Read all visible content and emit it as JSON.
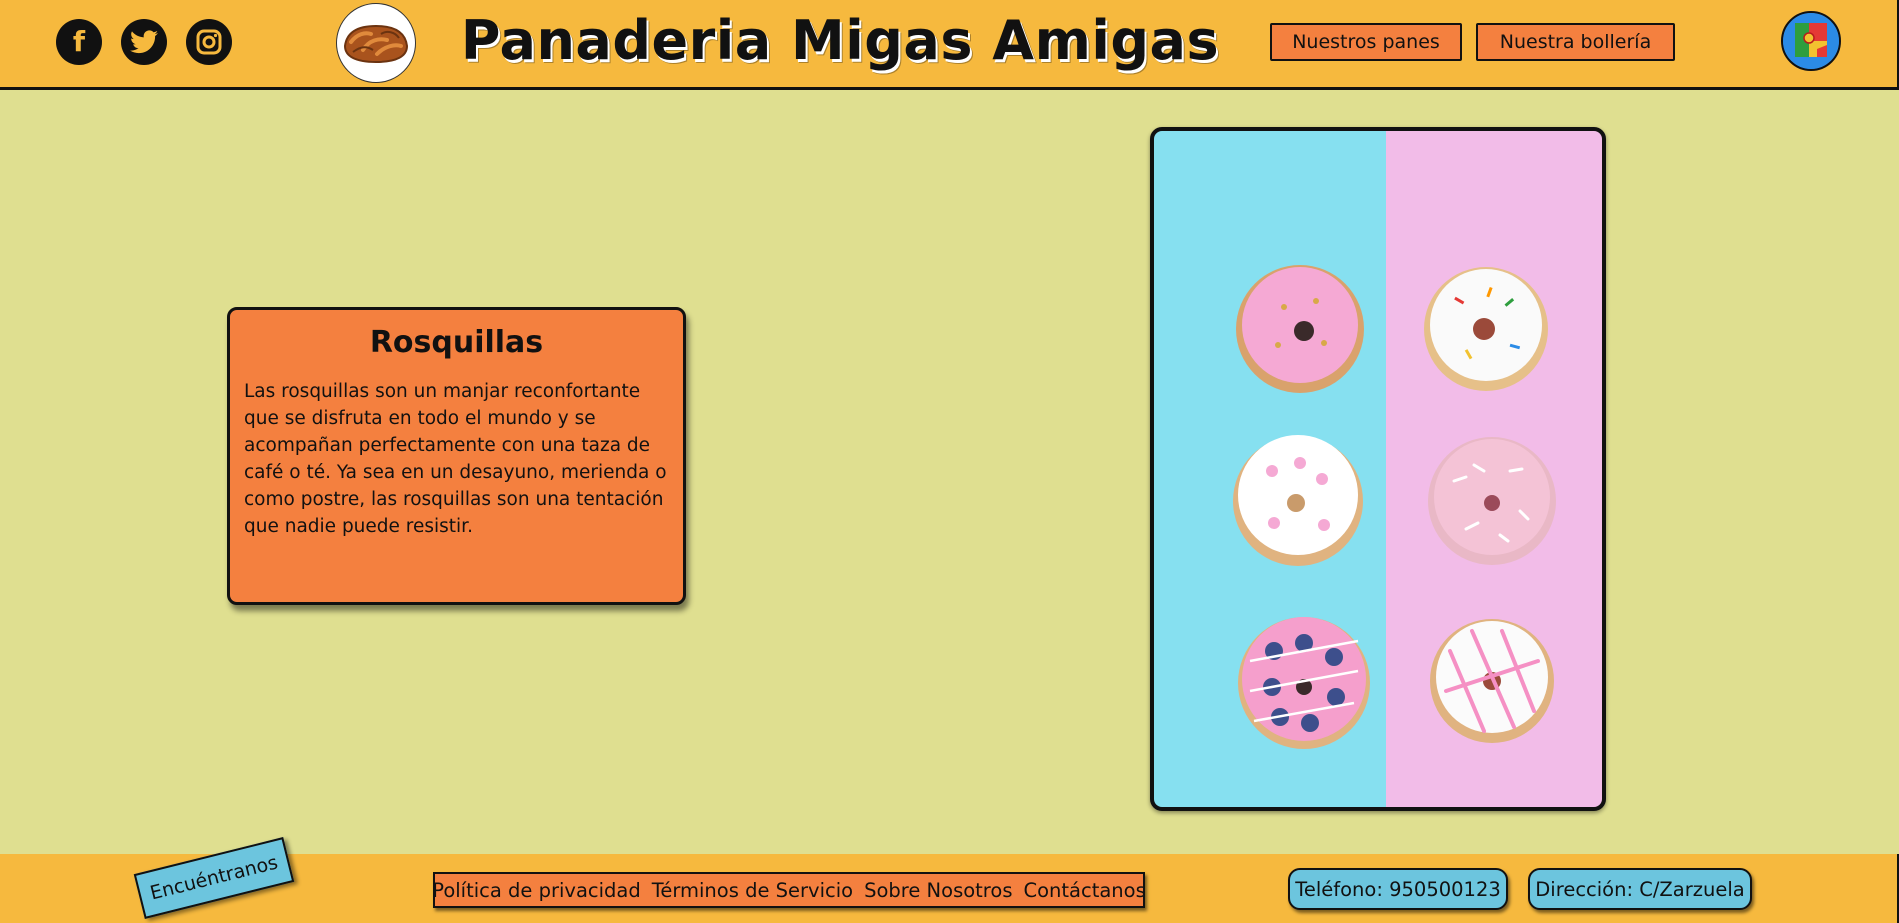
{
  "header": {
    "title": "Panaderia Migas Amigas",
    "social": [
      {
        "icon": "facebook-icon",
        "glyph": "f"
      },
      {
        "icon": "twitter-icon"
      },
      {
        "icon": "instagram-icon"
      }
    ],
    "logo_icon": "bread-logo-icon",
    "nav": [
      "Nuestros panes",
      "Nuestra bollería"
    ],
    "language_icon": "portugal-spain-flag-icon"
  },
  "card": {
    "title": "Rosquillas",
    "text": "Las rosquillas son un manjar reconfortante que se disfruta en todo el mundo y se acompañan perfectamente con una taza de café o té. Ya sea en un desayuno, merienda o como postre, las rosquillas son una tentación que nadie puede resistir."
  },
  "photo": {
    "icon": "donuts-photo"
  },
  "footer": {
    "find_us": "Encuéntranos",
    "links": [
      "Política de privacidad",
      "Términos de Servicio",
      "Sobre Nosotros",
      "Contáctanos"
    ],
    "phone": "Teléfono: 950500123",
    "address": "Dirección: C/Zarzuela"
  },
  "colors": {
    "background": "#dfdf90",
    "header_footer": "#f6b93e",
    "orange": "#f4803f",
    "blue": "#6cc5de"
  }
}
